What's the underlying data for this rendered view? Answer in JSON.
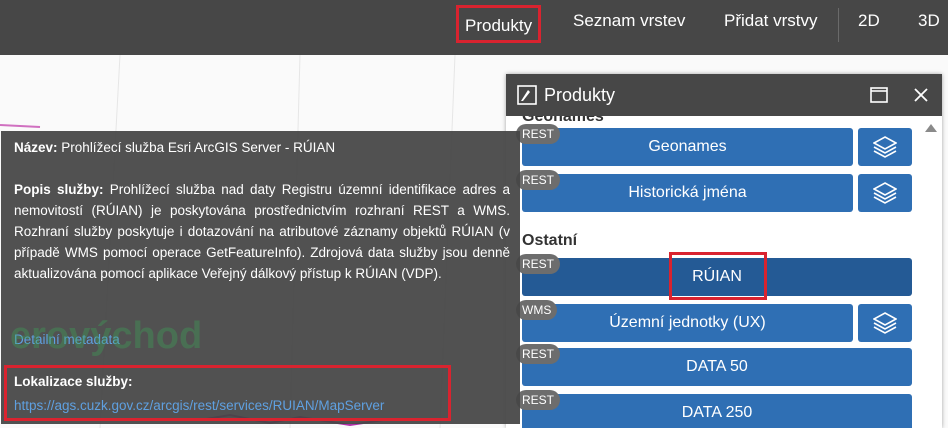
{
  "topbar": {
    "nav": [
      "Produkty",
      "Seznam vrstev",
      "Přidat vrstvy",
      "2D",
      "3D"
    ]
  },
  "panel": {
    "title": "Produkty",
    "section_top": "Geonames",
    "section_other": "Ostatní",
    "items": [
      {
        "badge": "REST",
        "label": "Geonames",
        "has_layers": true
      },
      {
        "badge": "REST",
        "label": "Historická jména",
        "has_layers": true
      },
      {
        "badge": "REST",
        "label": "RÚIAN",
        "has_layers": false,
        "active": true
      },
      {
        "badge": "WMS",
        "label": "Územní jednotky (UX)",
        "has_layers": true
      },
      {
        "badge": "REST",
        "label": "DATA 50",
        "has_layers": false
      },
      {
        "badge": "REST",
        "label": "DATA 250",
        "has_layers": false
      }
    ]
  },
  "tooltip": {
    "name_label": "Název:",
    "name_value": "Prohlížecí služba Esri ArcGIS Server - RÚIAN",
    "desc_label": "Popis služby:",
    "desc_value": "Prohlížecí služba nad daty Registru územní identifikace adres a nemovitostí (RÚIAN) je poskytována prostřednictvím rozhraní REST a WMS. Rozhraní služby poskytuje i dotazování na atributové záznamy objektů RÚIAN (v případě WMS pomocí operace GetFeatureInfo). Zdrojová data služby jsou denně aktualizována pomocí aplikace Veřejný dálkový přístup k RÚIAN (VDP).",
    "metadata_link": "Detailní metadata",
    "location_label": "Lokalizace služby:",
    "location_url": "https://ags.cuzk.gov.cz/arcgis/rest/services/RUIAN/MapServer"
  },
  "map": {
    "label": "erovýchod"
  },
  "colors": {
    "topbar": "#474747",
    "button": "#2f6fb4",
    "highlight": "#d9232f",
    "link": "#5fa0e0"
  }
}
